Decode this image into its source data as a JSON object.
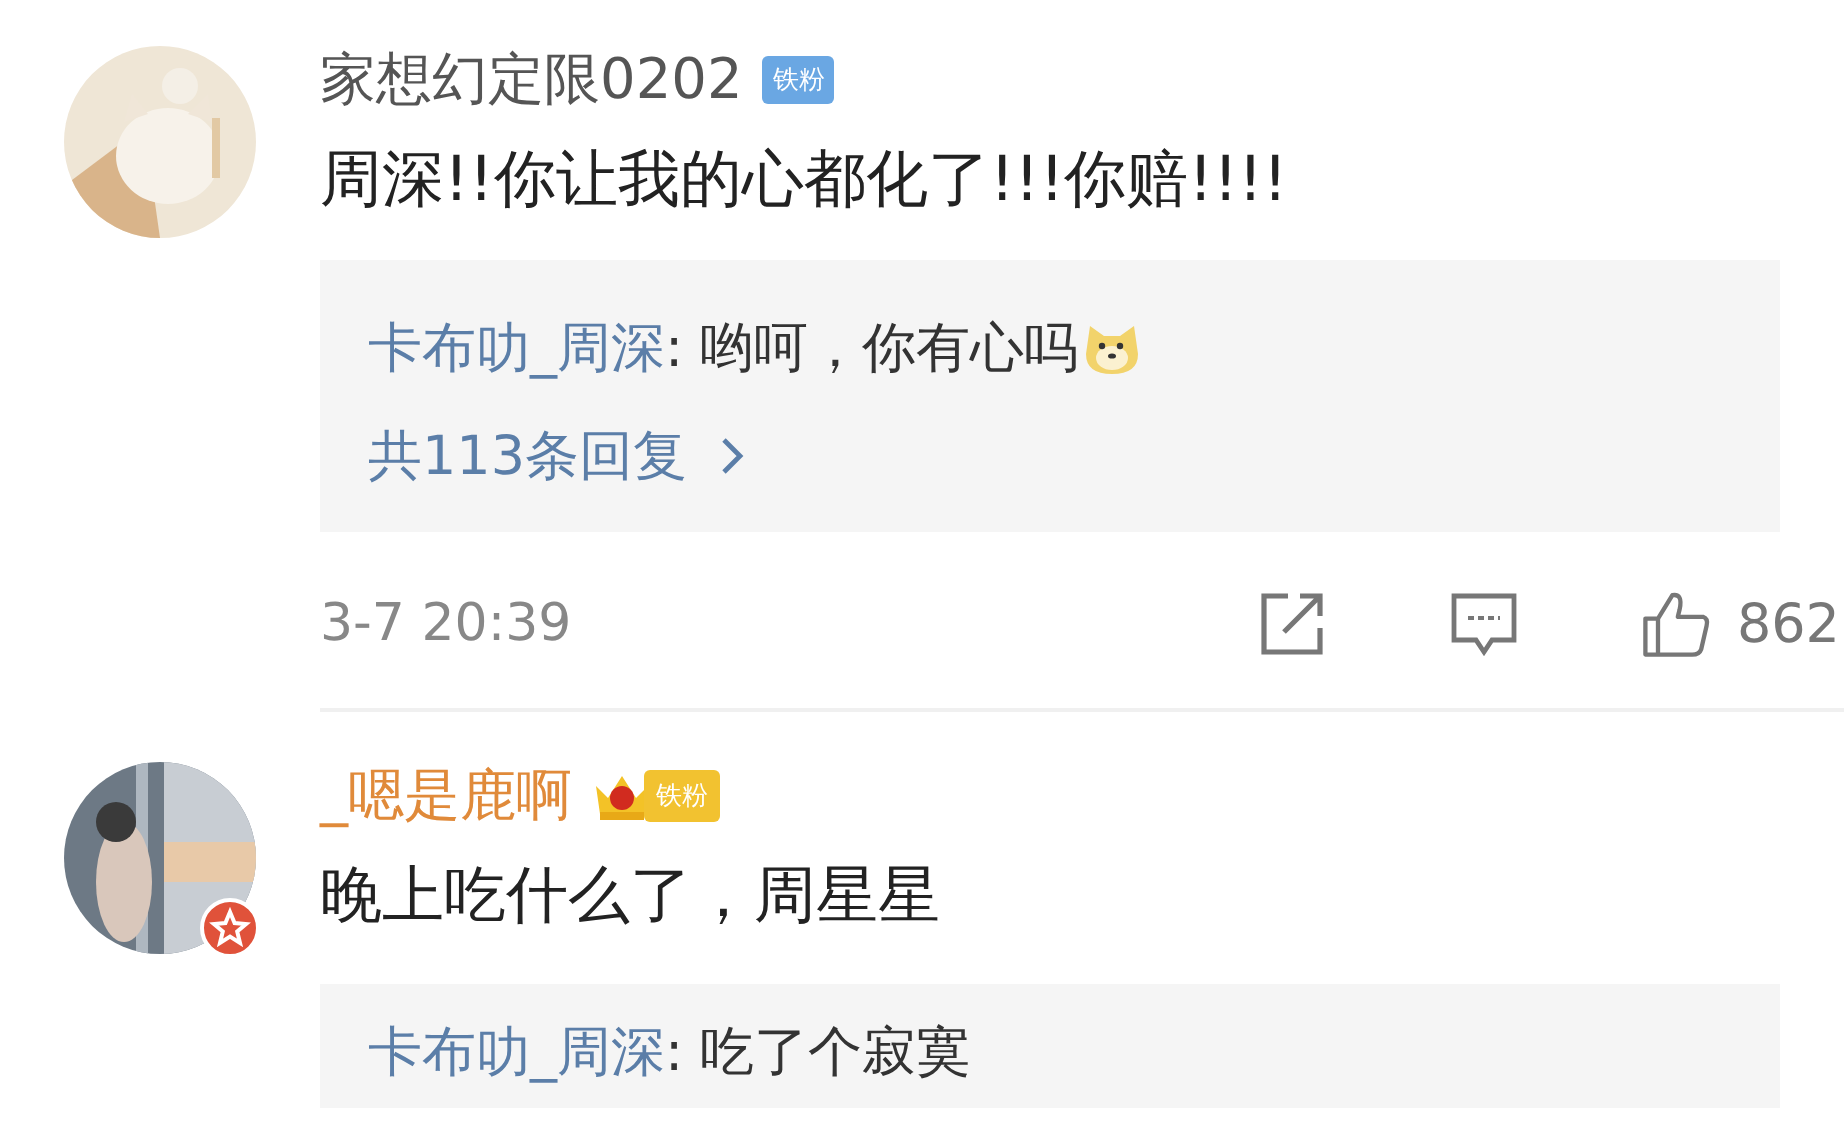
{
  "comments": [
    {
      "avatar": {
        "badge": false
      },
      "username": "家想幻定限0202",
      "vip": false,
      "fan_badge": {
        "kind": "plain",
        "label": "铁粉"
      },
      "text": "周深!!你让我的心都化了!!!你赔!!!!",
      "reply": {
        "author": "卡布叻_周深",
        "separator": ":",
        "text": " 哟呵，你有心吗",
        "emoji": true,
        "more": "共113条回复"
      },
      "time": "3-7 20:39",
      "likes": "862"
    },
    {
      "avatar": {
        "badge": true
      },
      "username": "_嗯是鹿啊",
      "vip": true,
      "fan_badge": {
        "kind": "crown",
        "label": "铁粉"
      },
      "text": "晚上吃什么了，周星星",
      "reply": {
        "author": "卡布叻_周深",
        "separator": ":",
        "text": " 吃了个寂寞",
        "emoji": false
      }
    }
  ]
}
